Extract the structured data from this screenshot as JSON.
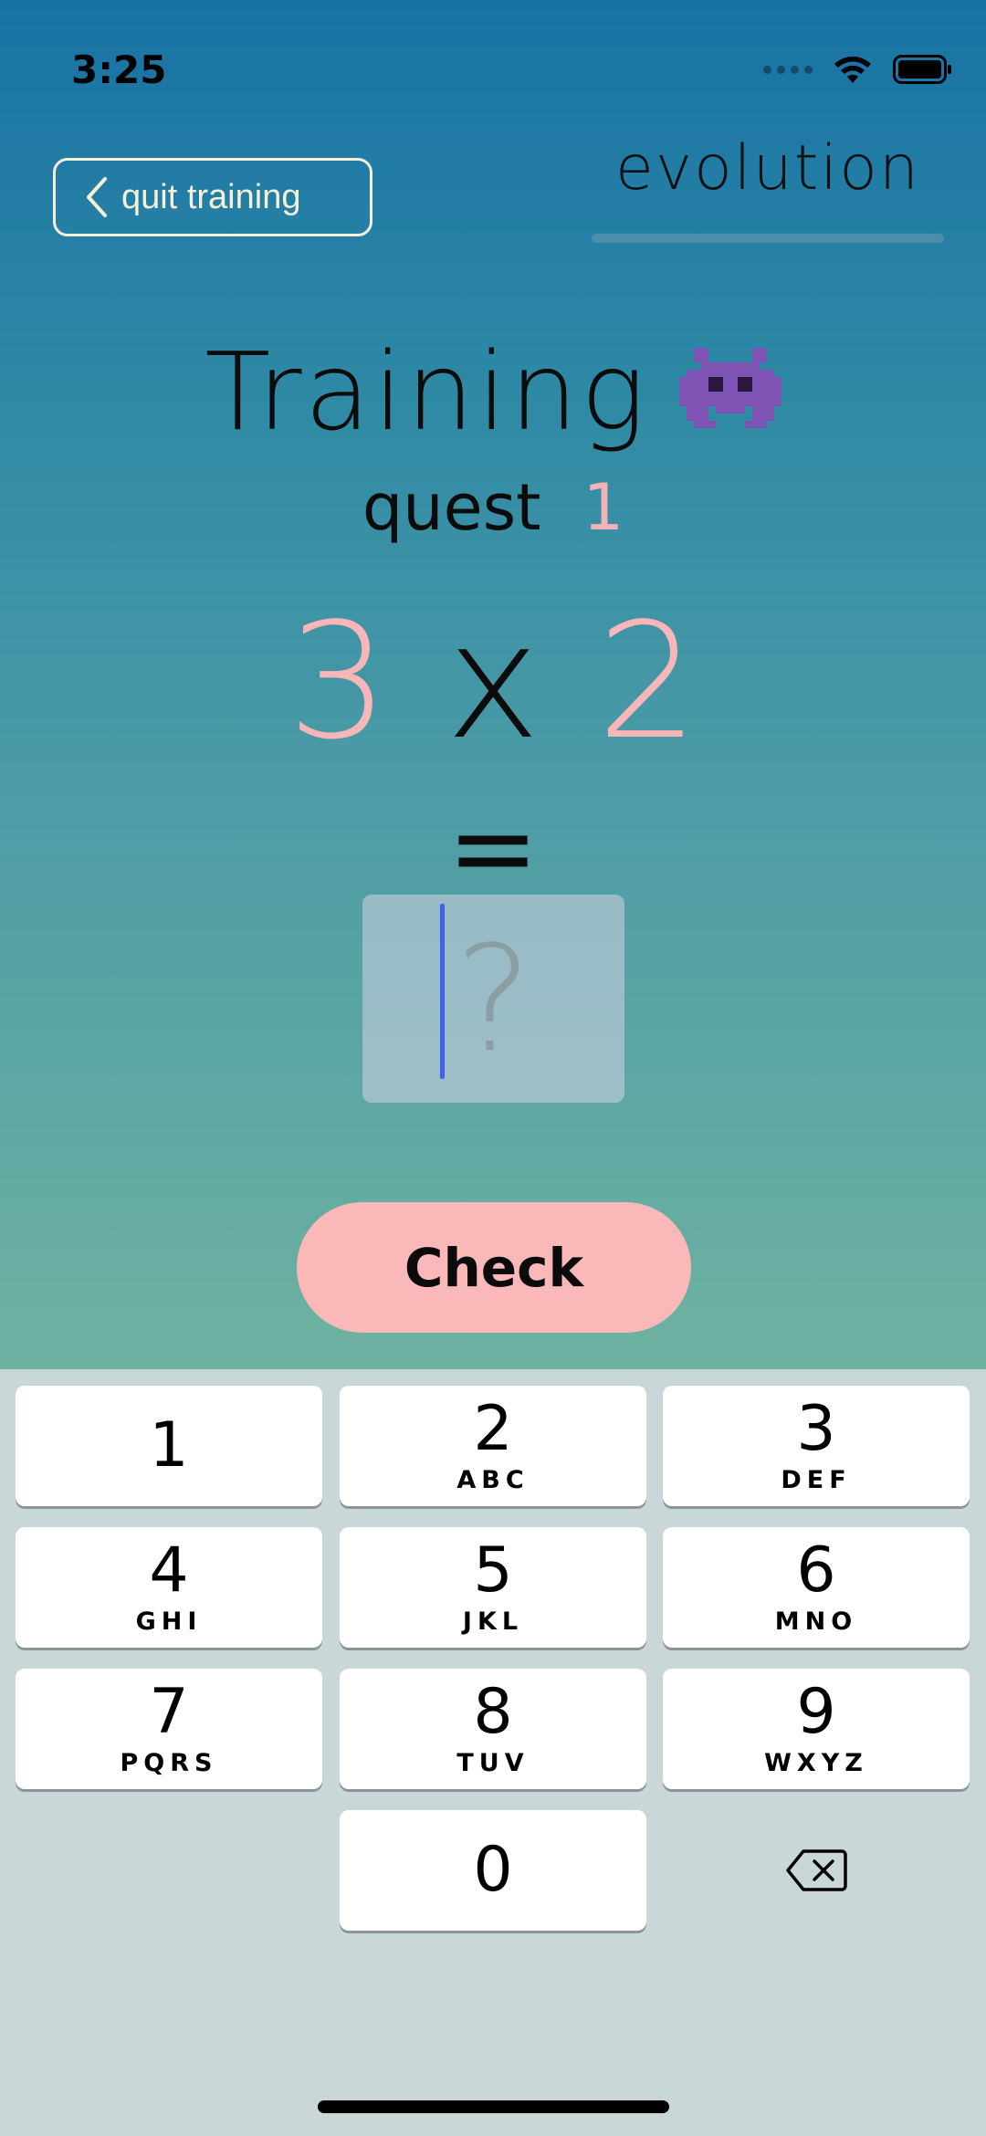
{
  "status_bar": {
    "time": "3:25"
  },
  "nav": {
    "quit_label": "quit training",
    "mode_label": "evolution"
  },
  "header": {
    "title": "Training",
    "emoji": "👾",
    "quest_label": "quest",
    "quest_number": "1"
  },
  "problem": {
    "left_operand": "3",
    "operator": "x",
    "right_operand": "2",
    "equals": "="
  },
  "answer": {
    "placeholder": "?"
  },
  "actions": {
    "check_label": "Check"
  },
  "keypad": {
    "keys": [
      {
        "digit": "1",
        "letters": ""
      },
      {
        "digit": "2",
        "letters": "ABC"
      },
      {
        "digit": "3",
        "letters": "DEF"
      },
      {
        "digit": "4",
        "letters": "GHI"
      },
      {
        "digit": "5",
        "letters": "JKL"
      },
      {
        "digit": "6",
        "letters": "MNO"
      },
      {
        "digit": "7",
        "letters": "PQRS"
      },
      {
        "digit": "8",
        "letters": "TUV"
      },
      {
        "digit": "9",
        "letters": "WXYZ"
      },
      {
        "digit": "0",
        "letters": ""
      }
    ],
    "delete_icon": "backspace-icon"
  },
  "colors": {
    "accent_pink": "#f7b6b8",
    "check_button": "#fbb8b8",
    "caret": "#3d64f0"
  }
}
